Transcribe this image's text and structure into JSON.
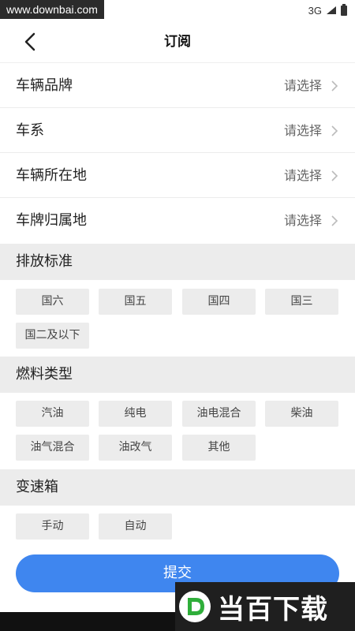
{
  "status_bar": {
    "watermark": "www.downbai.com",
    "network": "3G"
  },
  "header": {
    "title": "订阅"
  },
  "rows": [
    {
      "label": "车辆品牌",
      "value": "请选择"
    },
    {
      "label": "车系",
      "value": "请选择"
    },
    {
      "label": "车辆所在地",
      "value": "请选择"
    },
    {
      "label": "车牌归属地",
      "value": "请选择"
    }
  ],
  "emission": {
    "title": "排放标准",
    "options": [
      "国六",
      "国五",
      "国四",
      "国三",
      "国二及以下"
    ]
  },
  "fuel": {
    "title": "燃料类型",
    "options": [
      "汽油",
      "纯电",
      "油电混合",
      "柴油",
      "油气混合",
      "油改气",
      "其他"
    ]
  },
  "gearbox": {
    "title": "变速箱",
    "options": [
      "手动",
      "自动"
    ]
  },
  "submit_label": "提交",
  "watermark_logo": "当百下载",
  "colors": {
    "accent": "#3f86ef",
    "section_bg": "#ececec",
    "chip_bg": "#ececec"
  }
}
